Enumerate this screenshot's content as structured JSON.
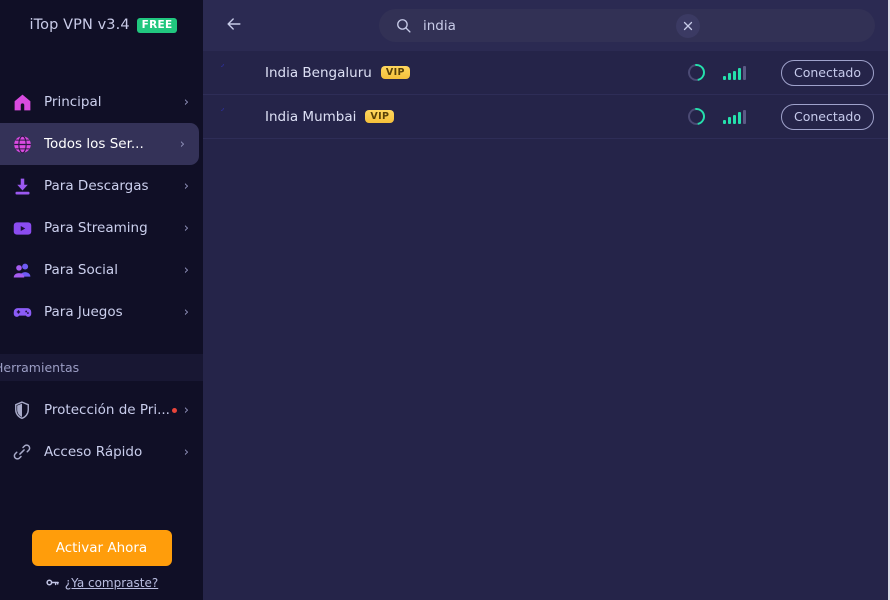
{
  "brand": {
    "name": "iTop VPN v3.4",
    "badge": "FREE"
  },
  "sidebar": {
    "items": [
      {
        "label": "Principal",
        "icon": "home-icon",
        "chevron": "›",
        "active": false
      },
      {
        "label": "Todos los Ser...",
        "icon": "globe-icon",
        "chevron": "›",
        "active": true
      },
      {
        "label": "Para Descargas",
        "icon": "download-icon",
        "chevron": "›",
        "active": false
      },
      {
        "label": "Para Streaming",
        "icon": "video-icon",
        "chevron": "›",
        "active": false
      },
      {
        "label": "Para Social",
        "icon": "people-icon",
        "chevron": "›",
        "active": false
      },
      {
        "label": "Para Juegos",
        "icon": "gamepad-icon",
        "chevron": "›",
        "active": false
      }
    ],
    "tools_section_label": "Herramientas",
    "tools": [
      {
        "label": "Protección de Pri...",
        "icon": "shield-icon",
        "chevron": "›",
        "dot": true
      },
      {
        "label": "Acceso Rápido",
        "icon": "link-icon",
        "chevron": "›",
        "dot": false
      }
    ],
    "cta": {
      "button_label": "Activar Ahora",
      "link_label": "¿Ya compraste?",
      "link_icon": "key-icon"
    }
  },
  "topbar": {
    "back_icon": "arrow-left-icon",
    "search": {
      "icon": "search-icon",
      "value": "india",
      "placeholder": "",
      "clear_icon": "close-icon"
    }
  },
  "servers": [
    {
      "name": "India Bengaluru",
      "badge": "VIP",
      "flag": "india-flag-icon",
      "loading_icon": "spinner-icon",
      "signal_icon": "signal-bars-icon",
      "signal_active": 4,
      "signal_total": 5,
      "status": "Conectado"
    },
    {
      "name": "India Mumbai",
      "badge": "VIP",
      "flag": "india-flag-icon",
      "loading_icon": "spinner-icon",
      "signal_icon": "signal-bars-icon",
      "signal_active": 4,
      "signal_total": 5,
      "status": "Conectado"
    }
  ],
  "colors": {
    "sidebar_bg": "#100f26",
    "main_bg": "#252449",
    "topbar_bg": "#2b2a52",
    "active_item": "#343258",
    "accent_orange": "#ff9d0b",
    "accent_green": "#21c77f",
    "signal_teal": "#25e0ac",
    "vip_gold": "#f5c03a",
    "notify_red": "#e8443a"
  }
}
